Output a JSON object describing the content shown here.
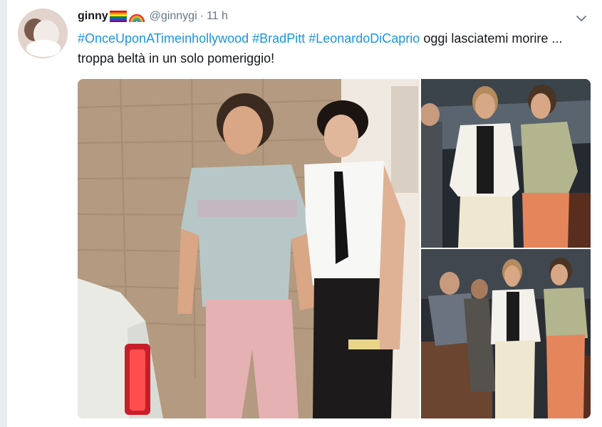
{
  "tweet": {
    "display_name": "ginny",
    "handle": "@ginnygi",
    "separator": "·",
    "time": "11 h",
    "text_parts": [
      {
        "text": "#OnceUponATimeinhollywood",
        "type": "hashtag"
      },
      {
        "text": " ",
        "type": "plain"
      },
      {
        "text": "#BradPitt",
        "type": "hashtag"
      },
      {
        "text": " ",
        "type": "plain"
      },
      {
        "text": "#LeonardoDiCaprio",
        "type": "hashtag"
      },
      {
        "text": " oggi lasciatemi morire ... troppa beltà in un solo pomeriggio!",
        "type": "plain"
      }
    ]
  },
  "icons": {
    "flag": "rainbow-flag-icon",
    "rainbow": "rainbow-icon",
    "menu": "chevron-down-icon"
  },
  "colors": {
    "hashtag": "#1b95e0",
    "secondary_text": "#657786",
    "primary_text": "#14171a"
  }
}
